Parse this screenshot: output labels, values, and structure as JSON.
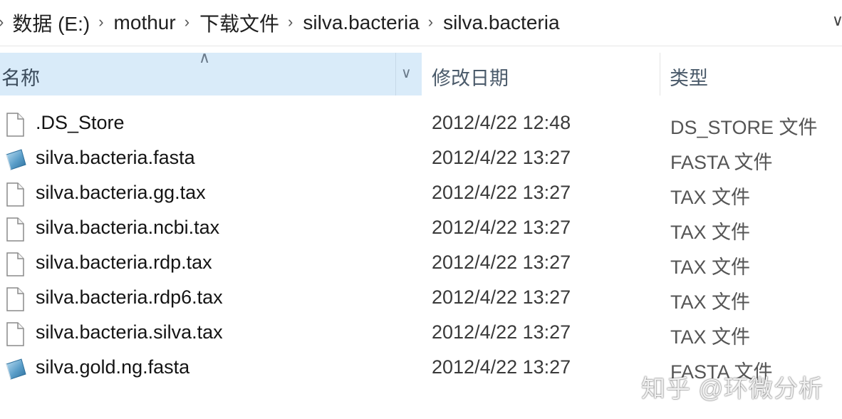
{
  "breadcrumb": {
    "items": [
      "数据 (E:)",
      "mothur",
      "下载文件",
      "silva.bacteria",
      "silva.bacteria"
    ]
  },
  "columns": {
    "name": "名称",
    "date": "修改日期",
    "type": "类型"
  },
  "files": [
    {
      "name": ".DS_Store",
      "date": "2012/4/22 12:48",
      "type": "DS_STORE 文件",
      "icon": "generic-file-icon"
    },
    {
      "name": "silva.bacteria.fasta",
      "date": "2012/4/22 13:27",
      "type": "FASTA 文件",
      "icon": "fasta-file-icon"
    },
    {
      "name": "silva.bacteria.gg.tax",
      "date": "2012/4/22 13:27",
      "type": "TAX 文件",
      "icon": "generic-file-icon"
    },
    {
      "name": "silva.bacteria.ncbi.tax",
      "date": "2012/4/22 13:27",
      "type": "TAX 文件",
      "icon": "generic-file-icon"
    },
    {
      "name": "silva.bacteria.rdp.tax",
      "date": "2012/4/22 13:27",
      "type": "TAX 文件",
      "icon": "generic-file-icon"
    },
    {
      "name": "silva.bacteria.rdp6.tax",
      "date": "2012/4/22 13:27",
      "type": "TAX 文件",
      "icon": "generic-file-icon"
    },
    {
      "name": "silva.bacteria.silva.tax",
      "date": "2012/4/22 13:27",
      "type": "TAX 文件",
      "icon": "generic-file-icon"
    },
    {
      "name": "silva.gold.ng.fasta",
      "date": "2012/4/22 13:27",
      "type": "FASTA 文件",
      "icon": "fasta-file-icon"
    }
  ],
  "watermark": "知乎 @环微分析",
  "colors": {
    "header_selected_bg": "#d9ebf9",
    "fasta_icon": "#5a9ec9"
  }
}
